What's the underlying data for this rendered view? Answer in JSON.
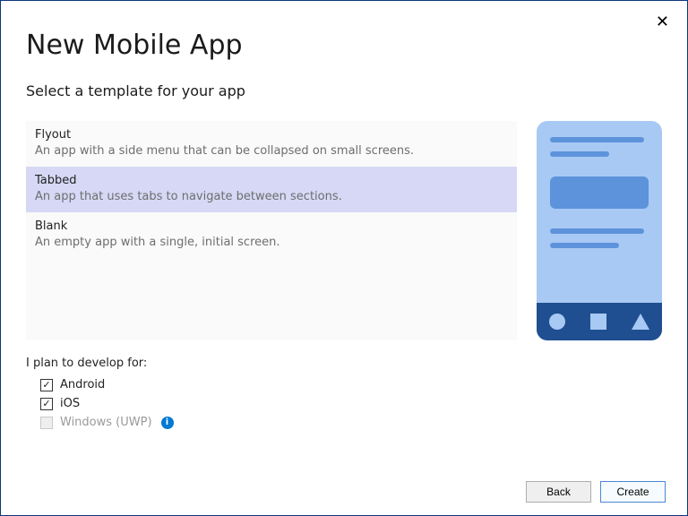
{
  "window": {
    "title": "New Mobile App",
    "subtitle": "Select a template for your app",
    "close_glyph": "✕"
  },
  "templates": [
    {
      "name": "Flyout",
      "desc": "An app with a side menu that can be collapsed on small screens.",
      "selected": false
    },
    {
      "name": "Tabbed",
      "desc": "An app that uses tabs to navigate between sections.",
      "selected": true
    },
    {
      "name": "Blank",
      "desc": "An empty app with a single, initial screen.",
      "selected": false
    }
  ],
  "plan": {
    "label": "I plan to develop for:",
    "targets": [
      {
        "name": "Android",
        "checked": true,
        "disabled": false
      },
      {
        "name": "iOS",
        "checked": true,
        "disabled": false
      },
      {
        "name": "Windows (UWP)",
        "checked": false,
        "disabled": true,
        "info": true
      }
    ]
  },
  "buttons": {
    "back": "Back",
    "create": "Create"
  },
  "info_glyph": "i",
  "check_glyph": "✓"
}
